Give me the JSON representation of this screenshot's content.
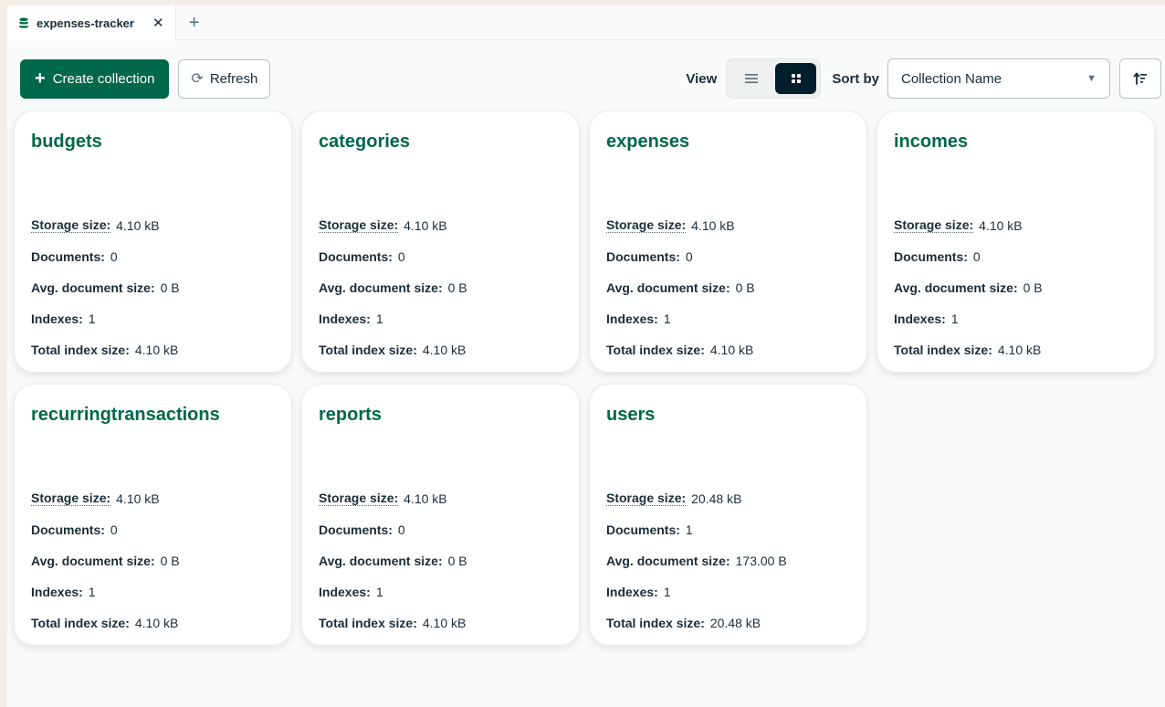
{
  "tab": {
    "title": "expenses-tracker",
    "close_glyph": "✕",
    "add_glyph": "+"
  },
  "toolbar": {
    "create_label": "Create collection",
    "refresh_label": "Refresh",
    "view_label": "View",
    "sort_label": "Sort by",
    "sort_value": "Collection Name"
  },
  "labels": {
    "storage_size": "Storage size:",
    "documents": "Documents:",
    "avg_doc_size": "Avg. document size:",
    "indexes": "Indexes:",
    "total_index_size": "Total index size:"
  },
  "collections": [
    {
      "name": "budgets",
      "storage_size": "4.10 kB",
      "documents": "0",
      "avg_doc_size": "0 B",
      "indexes": "1",
      "total_index_size": "4.10 kB"
    },
    {
      "name": "categories",
      "storage_size": "4.10 kB",
      "documents": "0",
      "avg_doc_size": "0 B",
      "indexes": "1",
      "total_index_size": "4.10 kB"
    },
    {
      "name": "expenses",
      "storage_size": "4.10 kB",
      "documents": "0",
      "avg_doc_size": "0 B",
      "indexes": "1",
      "total_index_size": "4.10 kB"
    },
    {
      "name": "incomes",
      "storage_size": "4.10 kB",
      "documents": "0",
      "avg_doc_size": "0 B",
      "indexes": "1",
      "total_index_size": "4.10 kB"
    },
    {
      "name": "recurringtransactions",
      "storage_size": "4.10 kB",
      "documents": "0",
      "avg_doc_size": "0 B",
      "indexes": "1",
      "total_index_size": "4.10 kB"
    },
    {
      "name": "reports",
      "storage_size": "4.10 kB",
      "documents": "0",
      "avg_doc_size": "0 B",
      "indexes": "1",
      "total_index_size": "4.10 kB"
    },
    {
      "name": "users",
      "storage_size": "20.48 kB",
      "documents": "1",
      "avg_doc_size": "173.00 B",
      "indexes": "1",
      "total_index_size": "20.48 kB"
    }
  ],
  "icons": {
    "tab": "database-icon",
    "create": "plus-icon",
    "refresh": "refresh-icon",
    "list_view": "list-view-icon",
    "grid_view": "grid-view-icon",
    "sort_caret": "caret-down-icon",
    "sort_direction": "sort-ascending-icon"
  },
  "colors": {
    "accent": "#00684a",
    "dark": "#001e2b",
    "background": "#f3eee6"
  }
}
